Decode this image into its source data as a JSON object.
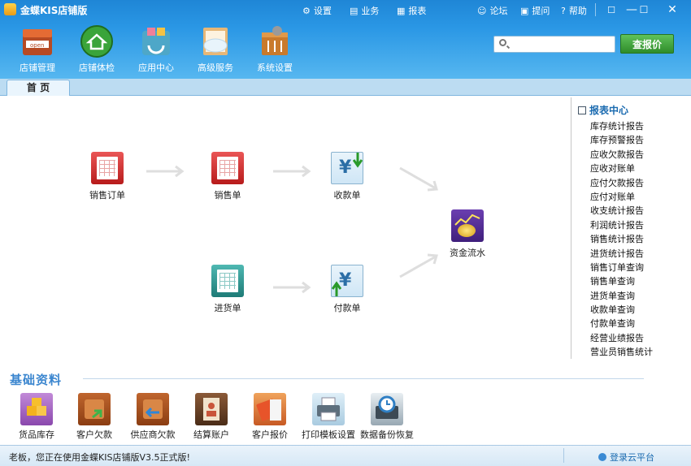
{
  "window": {
    "title": "金蝶KIS店铺版",
    "controls": [
      "☐",
      "—",
      "☐",
      "✕"
    ]
  },
  "top_menu": [
    {
      "icon": "gear-icon",
      "label": "设置"
    },
    {
      "icon": "business-icon",
      "label": "业务"
    },
    {
      "icon": "report-icon",
      "label": "报表"
    },
    {
      "icon": "forum-icon",
      "label": "论坛"
    },
    {
      "icon": "ask-icon",
      "label": "提问"
    },
    {
      "icon": "help-icon",
      "label": "帮助"
    }
  ],
  "toolbar": [
    {
      "icon": "store-icon",
      "label": "店铺管理"
    },
    {
      "icon": "house-check-icon",
      "label": "店铺体检"
    },
    {
      "icon": "app-center-icon",
      "label": "应用中心"
    },
    {
      "icon": "cloud-service-icon",
      "label": "高级服务"
    },
    {
      "icon": "settings-box-icon",
      "label": "系统设置"
    }
  ],
  "search": {
    "placeholder": "",
    "button": "查报价"
  },
  "tabs": [
    {
      "label": "首 页"
    }
  ],
  "flow": {
    "sales_order": "销售订单",
    "sales": "销售单",
    "receipt": "收款单",
    "purchase": "进货单",
    "payment": "付款单",
    "cash_flow": "资金流水"
  },
  "report_center": {
    "title": "报表中心",
    "items": [
      "库存统计报告",
      "库存预警报告",
      "应收欠款报告",
      "应收对账单",
      "应付欠款报告",
      "应付对账单",
      "收支统计报告",
      "利润统计报告",
      "销售统计报告",
      "进货统计报告",
      "销售订单查询",
      "销售单查询",
      "进货单查询",
      "收款单查询",
      "付款单查询",
      "经营业绩报告",
      "营业员销售统计"
    ]
  },
  "basic_info": {
    "title": "基础资料",
    "items": [
      {
        "icon": "goods-stock-icon",
        "label": "货品库存"
      },
      {
        "icon": "customer-debt-icon",
        "label": "客户欠款"
      },
      {
        "icon": "supplier-debt-icon",
        "label": "供应商欠款"
      },
      {
        "icon": "settlement-account-icon",
        "label": "结算账户"
      },
      {
        "icon": "customer-quote-icon",
        "label": "客户报价"
      },
      {
        "icon": "printer-icon",
        "label": "打印模板设置"
      },
      {
        "icon": "backup-restore-icon",
        "label": "数据备份恢复"
      }
    ]
  },
  "status_bar": {
    "message": "老板，您正在使用金蝶KIS店铺版V3.5正式版!",
    "login": "登录云平台"
  }
}
